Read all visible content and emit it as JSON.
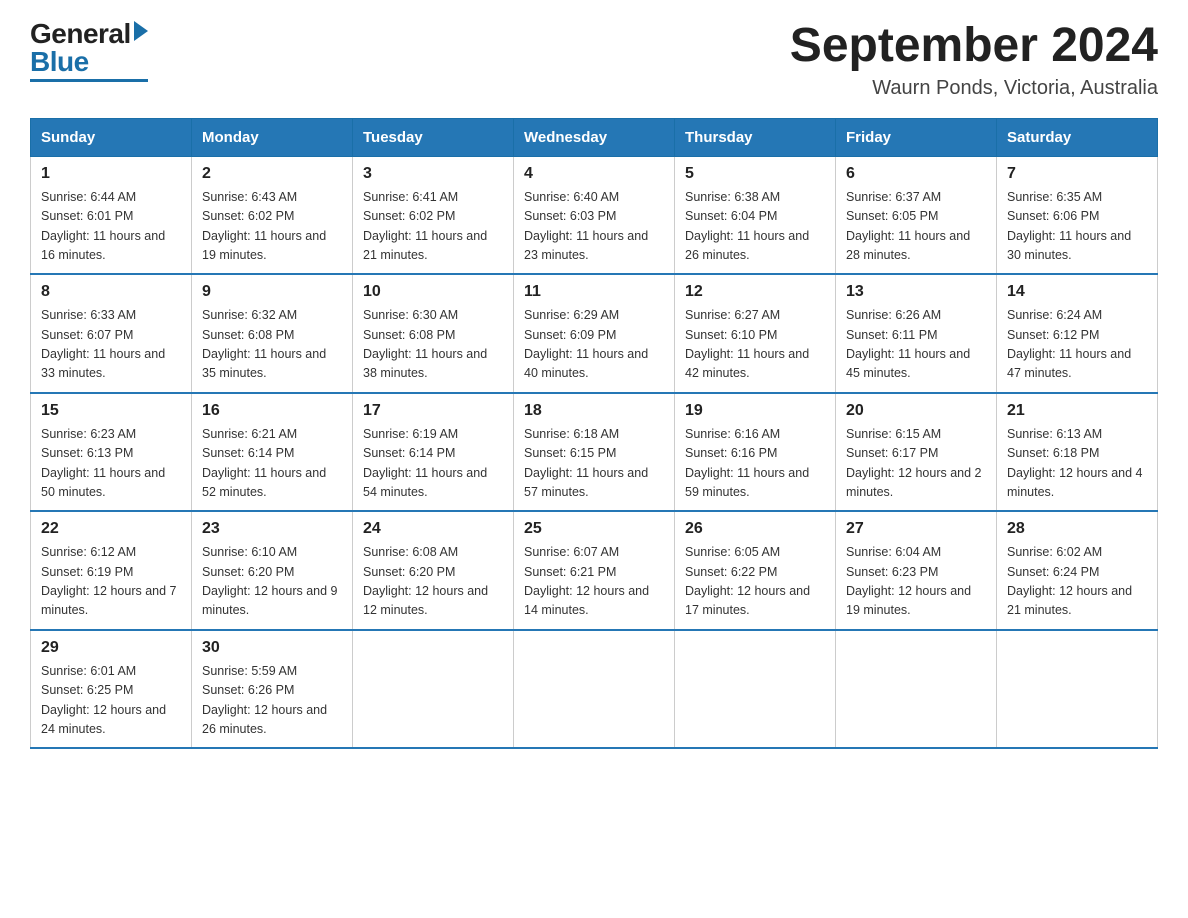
{
  "header": {
    "logo_general": "General",
    "logo_blue": "Blue",
    "month_year": "September 2024",
    "location": "Waurn Ponds, Victoria, Australia"
  },
  "days_of_week": [
    "Sunday",
    "Monday",
    "Tuesday",
    "Wednesday",
    "Thursday",
    "Friday",
    "Saturday"
  ],
  "weeks": [
    [
      {
        "num": "1",
        "sunrise": "6:44 AM",
        "sunset": "6:01 PM",
        "daylight": "11 hours and 16 minutes."
      },
      {
        "num": "2",
        "sunrise": "6:43 AM",
        "sunset": "6:02 PM",
        "daylight": "11 hours and 19 minutes."
      },
      {
        "num": "3",
        "sunrise": "6:41 AM",
        "sunset": "6:02 PM",
        "daylight": "11 hours and 21 minutes."
      },
      {
        "num": "4",
        "sunrise": "6:40 AM",
        "sunset": "6:03 PM",
        "daylight": "11 hours and 23 minutes."
      },
      {
        "num": "5",
        "sunrise": "6:38 AM",
        "sunset": "6:04 PM",
        "daylight": "11 hours and 26 minutes."
      },
      {
        "num": "6",
        "sunrise": "6:37 AM",
        "sunset": "6:05 PM",
        "daylight": "11 hours and 28 minutes."
      },
      {
        "num": "7",
        "sunrise": "6:35 AM",
        "sunset": "6:06 PM",
        "daylight": "11 hours and 30 minutes."
      }
    ],
    [
      {
        "num": "8",
        "sunrise": "6:33 AM",
        "sunset": "6:07 PM",
        "daylight": "11 hours and 33 minutes."
      },
      {
        "num": "9",
        "sunrise": "6:32 AM",
        "sunset": "6:08 PM",
        "daylight": "11 hours and 35 minutes."
      },
      {
        "num": "10",
        "sunrise": "6:30 AM",
        "sunset": "6:08 PM",
        "daylight": "11 hours and 38 minutes."
      },
      {
        "num": "11",
        "sunrise": "6:29 AM",
        "sunset": "6:09 PM",
        "daylight": "11 hours and 40 minutes."
      },
      {
        "num": "12",
        "sunrise": "6:27 AM",
        "sunset": "6:10 PM",
        "daylight": "11 hours and 42 minutes."
      },
      {
        "num": "13",
        "sunrise": "6:26 AM",
        "sunset": "6:11 PM",
        "daylight": "11 hours and 45 minutes."
      },
      {
        "num": "14",
        "sunrise": "6:24 AM",
        "sunset": "6:12 PM",
        "daylight": "11 hours and 47 minutes."
      }
    ],
    [
      {
        "num": "15",
        "sunrise": "6:23 AM",
        "sunset": "6:13 PM",
        "daylight": "11 hours and 50 minutes."
      },
      {
        "num": "16",
        "sunrise": "6:21 AM",
        "sunset": "6:14 PM",
        "daylight": "11 hours and 52 minutes."
      },
      {
        "num": "17",
        "sunrise": "6:19 AM",
        "sunset": "6:14 PM",
        "daylight": "11 hours and 54 minutes."
      },
      {
        "num": "18",
        "sunrise": "6:18 AM",
        "sunset": "6:15 PM",
        "daylight": "11 hours and 57 minutes."
      },
      {
        "num": "19",
        "sunrise": "6:16 AM",
        "sunset": "6:16 PM",
        "daylight": "11 hours and 59 minutes."
      },
      {
        "num": "20",
        "sunrise": "6:15 AM",
        "sunset": "6:17 PM",
        "daylight": "12 hours and 2 minutes."
      },
      {
        "num": "21",
        "sunrise": "6:13 AM",
        "sunset": "6:18 PM",
        "daylight": "12 hours and 4 minutes."
      }
    ],
    [
      {
        "num": "22",
        "sunrise": "6:12 AM",
        "sunset": "6:19 PM",
        "daylight": "12 hours and 7 minutes."
      },
      {
        "num": "23",
        "sunrise": "6:10 AM",
        "sunset": "6:20 PM",
        "daylight": "12 hours and 9 minutes."
      },
      {
        "num": "24",
        "sunrise": "6:08 AM",
        "sunset": "6:20 PM",
        "daylight": "12 hours and 12 minutes."
      },
      {
        "num": "25",
        "sunrise": "6:07 AM",
        "sunset": "6:21 PM",
        "daylight": "12 hours and 14 minutes."
      },
      {
        "num": "26",
        "sunrise": "6:05 AM",
        "sunset": "6:22 PM",
        "daylight": "12 hours and 17 minutes."
      },
      {
        "num": "27",
        "sunrise": "6:04 AM",
        "sunset": "6:23 PM",
        "daylight": "12 hours and 19 minutes."
      },
      {
        "num": "28",
        "sunrise": "6:02 AM",
        "sunset": "6:24 PM",
        "daylight": "12 hours and 21 minutes."
      }
    ],
    [
      {
        "num": "29",
        "sunrise": "6:01 AM",
        "sunset": "6:25 PM",
        "daylight": "12 hours and 24 minutes."
      },
      {
        "num": "30",
        "sunrise": "5:59 AM",
        "sunset": "6:26 PM",
        "daylight": "12 hours and 26 minutes."
      },
      null,
      null,
      null,
      null,
      null
    ]
  ],
  "labels": {
    "sunrise_prefix": "Sunrise: ",
    "sunset_prefix": "Sunset: ",
    "daylight_prefix": "Daylight: "
  }
}
